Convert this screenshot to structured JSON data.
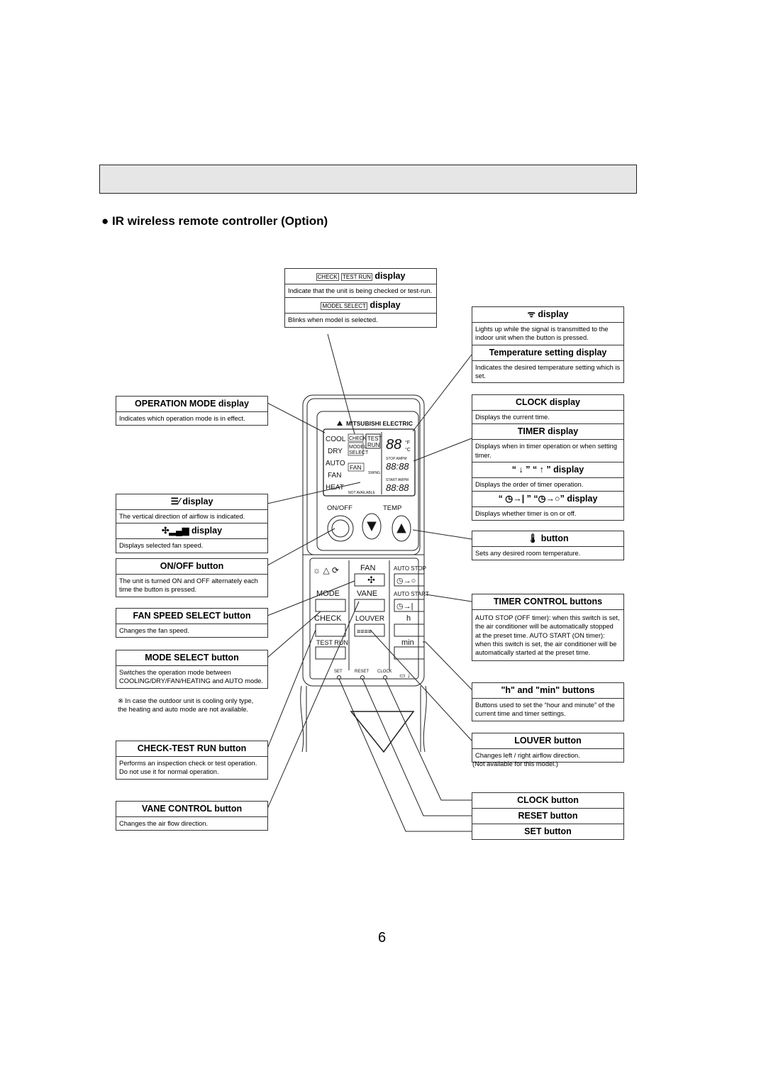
{
  "section_title": "● IR wireless remote controller (Option)",
  "page_number": "6",
  "boxes": {
    "check_test": {
      "title": "display",
      "icon": "check-testrun-icon",
      "icon_text": [
        "CHECK",
        "TEST RUN"
      ],
      "desc": "Indicate that the unit is being checked or test-run."
    },
    "model_select": {
      "title": "display",
      "icon_text": "MODEL SELECT",
      "desc": "Blinks when model is selected."
    },
    "signal": {
      "title": "display",
      "icon": "signal-icon",
      "desc": "Lights up while the signal is transmitted to the indoor unit when the button is pressed."
    },
    "temp_setting": {
      "title": "Temperature setting display",
      "desc": "Indicates the desired temperature setting which is set."
    },
    "operation_mode": {
      "title": "OPERATION MODE display",
      "desc": "Indicates which operation mode is in effect."
    },
    "clock": {
      "title": "CLOCK display",
      "desc": "Displays the current time."
    },
    "timer": {
      "title": "TIMER display",
      "desc": "Displays when in timer operation or when setting timer."
    },
    "arrows": {
      "title": "“ ↓ ” “ ↑ ” display",
      "desc": "Displays the order of timer operation."
    },
    "timer_icons": {
      "title": "“ ◷→| ” “◷→○” display",
      "desc": "Displays whether timer is on or off."
    },
    "vane_display": {
      "title": "display",
      "icon": "vane-icon",
      "desc": "The vertical direction of airflow is indicated."
    },
    "fan_display": {
      "title": "display",
      "icon": "fan-speed-icon",
      "desc": "Displays selected fan speed."
    },
    "temp_button": {
      "title": "button",
      "icon": "thermometer-icon",
      "desc": "Sets any desired room temperature."
    },
    "onoff": {
      "title": "ON/OFF button",
      "desc": "The unit is turned ON and OFF alternately each time the button is pressed."
    },
    "timer_control": {
      "title": "TIMER CONTROL buttons",
      "desc": "AUTO STOP (OFF timer): when this switch is set, the air conditioner will be automatically stopped at the preset time. AUTO START (ON timer): when this switch is set, the air conditioner will be automatically started at the preset time."
    },
    "fan_speed": {
      "title": "FAN SPEED SELECT button",
      "desc": "Changes the fan speed."
    },
    "mode_select": {
      "title": "MODE SELECT button",
      "desc": "Switches the operation mode between COOLING/DRY/FAN/HEATING and AUTO mode.",
      "note": "※ In case the outdoor unit is cooling only type, the heating and auto mode are not available."
    },
    "hmin": {
      "title": "\"h\" and \"min\" buttons",
      "desc": "Buttons used to set the “hour and minute” of the current time and timer settings."
    },
    "louver": {
      "title": "LOUVER button",
      "desc": "Changes left / right airflow direction.",
      "note": "(Not available for this model.)"
    },
    "check_test_run": {
      "title": "CHECK-TEST RUN button",
      "desc": "Performs an inspection  check or test operation. Do not use it for normal operation."
    },
    "vane_control": {
      "title": "VANE CONTROL button",
      "desc": "Changes the air flow direction."
    },
    "clock_button": {
      "title": "CLOCK button"
    },
    "reset_button": {
      "title": "RESET button"
    },
    "set_button": {
      "title": "SET button"
    }
  },
  "remote": {
    "brand": "MITSUBISHI ELECTRIC",
    "modes": [
      "COOL",
      "DRY",
      "AUTO",
      "FAN",
      "HEAT"
    ],
    "check": "CHECK",
    "test": "TEST",
    "run": "RUN",
    "model": "MODEL",
    "select": "SELECT",
    "fan_tag": "FAN",
    "swing": "SWING",
    "temp_digits": "88",
    "unit_f": "°F",
    "unit_c": "°C",
    "stop_ampm": "STOP AMPM",
    "start_ampm": "START AMPM",
    "time": "88:88",
    "not_available": "NOT AVAILABLE",
    "onoff": "ON/OFF",
    "temp": "TEMP",
    "fan": "FAN",
    "mode": "MODE",
    "vane": "VANE",
    "check_btn": "CHECK",
    "louver": "LOUVER",
    "test_run": "TEST RUN",
    "auto_stop": "AUTO STOP",
    "auto_start": "AUTO START",
    "h": "h",
    "min": "min",
    "set": "SET",
    "reset": "RESET",
    "clock": "CLOCK"
  }
}
